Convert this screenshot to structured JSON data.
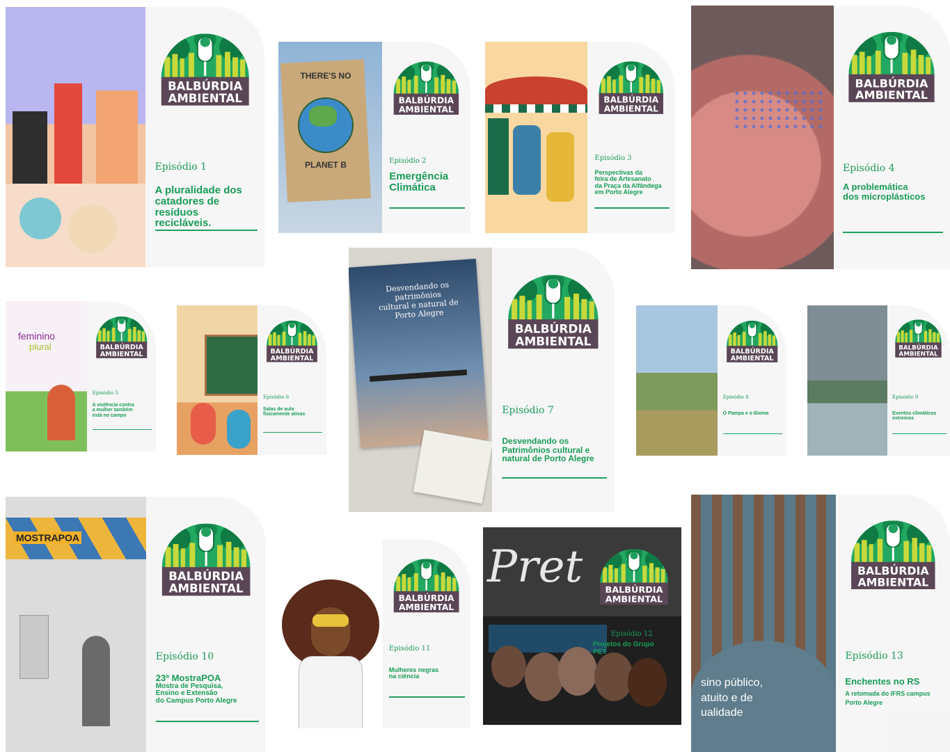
{
  "logo": {
    "line1": "BALBÚRDIA",
    "line2": "AMBIENTAL"
  },
  "episodes": [
    {
      "ep": "Episódio 1",
      "title": [
        "A pluralidade dos",
        "catadores de",
        "resíduos recicláveis."
      ]
    },
    {
      "ep": "Episódio 2",
      "title": [
        "Emergência",
        "Climática"
      ]
    },
    {
      "ep": "Episódio 3",
      "title": [
        "Perspectivas da",
        "feira de Artesanato",
        "da Praça da Alfândega",
        "em Porto Alegre"
      ]
    },
    {
      "ep": "Episódio 4",
      "title": [
        "A problemática",
        "dos microplásticos"
      ]
    },
    {
      "ep": "Episódio 5",
      "title": [
        "A violência contra",
        "a mulher também",
        "está no campo"
      ]
    },
    {
      "ep": "Episódio 6",
      "title": [
        "Salas de aula",
        "fisicamente ativas"
      ]
    },
    {
      "ep": "Episódio 7",
      "title": [
        "Desvendando os",
        "Patrimônios cultural e",
        "natural de Porto Alegre"
      ]
    },
    {
      "ep": "Episódio 8",
      "title": [
        "O Pampa e o Bioma"
      ]
    },
    {
      "ep": "Episódio 9",
      "title": [
        "Eventos climáticos",
        "extremos"
      ]
    },
    {
      "ep": "Episódio 10",
      "title": [
        "23ª MostraPOA",
        "Mostra de Pesquisa,",
        "Ensino e Extensão",
        "do Campus Porto Alegre"
      ]
    },
    {
      "ep": "Episódio 11",
      "title": [
        "Mulheres negras",
        "na ciência"
      ]
    },
    {
      "ep": "Episódio 12",
      "title": [
        "Projetos do Grupo PET"
      ]
    },
    {
      "ep": "Episódio 13",
      "title": [
        "Enchentes no RS",
        "A retomada do IFRS campus",
        "Porto Alegre"
      ]
    }
  ],
  "art_text": {
    "planet": [
      "THERE'S NO",
      "PLANET B"
    ],
    "feminino": [
      "feminino",
      "plural"
    ],
    "book": [
      "Desvendando os patrimônios",
      "cultural e natural de",
      "Porto Alegre"
    ],
    "mostra": "MOSTRAPOA",
    "pret": "Pret",
    "sign": [
      "sino público,",
      "atuito e de",
      "ualidade"
    ]
  },
  "colors": {
    "green": "#1e9a5c",
    "logo_plate": "#5a4656",
    "logo_dome": "#1fa05e",
    "logo_trees": "#c9d83a"
  }
}
